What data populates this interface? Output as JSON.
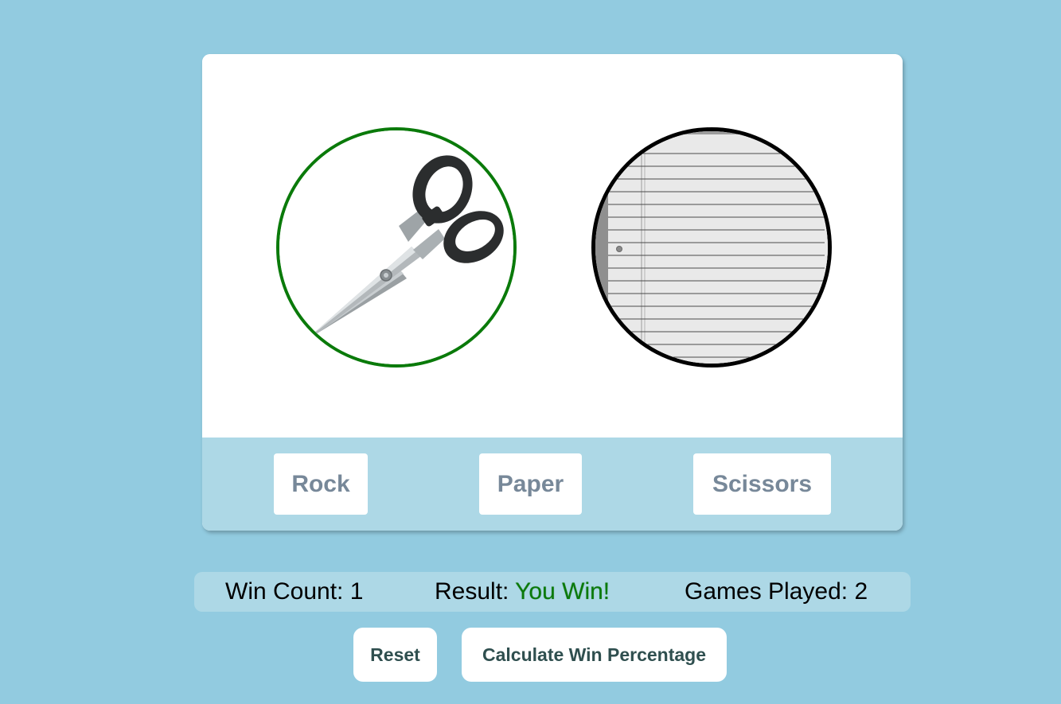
{
  "game": {
    "player_choice": {
      "icon": "scissors-icon",
      "border_color": "#0a7a0a"
    },
    "computer_choice": {
      "icon": "paper-icon",
      "border_color": "#000000"
    },
    "buttons": {
      "rock": "Rock",
      "paper": "Paper",
      "scissors": "Scissors"
    }
  },
  "stats": {
    "win_count_label": "Win Count:",
    "win_count": "1",
    "result_label": "Result:",
    "result_value": "You Win!",
    "games_played_label": "Games Played:",
    "games_played": "2"
  },
  "actions": {
    "reset": "Reset",
    "calculate": "Calculate Win Percentage"
  },
  "colors": {
    "page_background": "#92cbe0",
    "panel_background": "#add8e6",
    "win_color": "#0a7a0a",
    "choice_button_text": "#778899",
    "action_button_text": "#2f4f4f"
  }
}
